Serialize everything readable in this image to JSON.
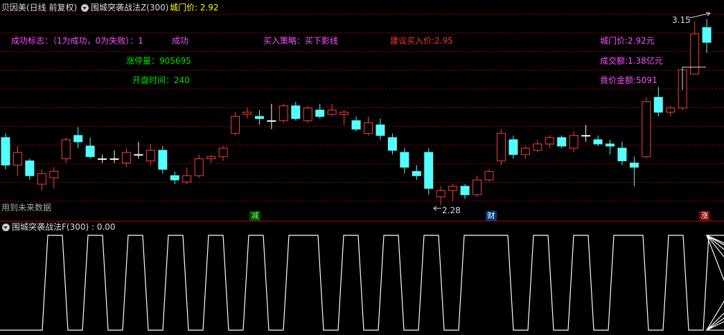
{
  "main_panel": {
    "stock_title": "贝因美(日线 前复权)",
    "indicator_title": "围城突袭战法Z(300)",
    "header_price_label": "城门价: 2.92",
    "high_marker": "3.15",
    "low_marker": "2.28",
    "future_data_note": "用到未来数据",
    "labels": {
      "success_flag": "成功标志：（1为成功，0为失败）：1",
      "success_text": "成功",
      "buy_strategy": "买入策略：买下影线",
      "suggested_price": "建议买入价:2.95",
      "city_gate_price": "城门价:2.92元",
      "limit_up_volume": "涨停量：905695",
      "turnover": "成交额:1.38亿元",
      "open_time": "开盘时间：240",
      "auction_amount": "竟价金额:5091"
    },
    "badges": {
      "reduce": "减",
      "finance": "财",
      "rise": "涨"
    }
  },
  "sub_panel": {
    "title": "围城突袭战法F(300) : 0.00"
  },
  "colors": {
    "up": "#ff3c3c",
    "down": "#54ffff",
    "flat": "#ffffff",
    "grid": "#7a0000",
    "magenta": "#ff50ff",
    "green": "#00e000",
    "yellow": "#ffff00"
  },
  "chart_data": [
    {
      "type": "candlestick",
      "title": "贝因美(日线 前复权)",
      "ohlc": [
        [
          2.6,
          2.62,
          2.45,
          2.47
        ],
        [
          2.47,
          2.56,
          2.42,
          2.53
        ],
        [
          2.49,
          2.5,
          2.4,
          2.42
        ],
        [
          2.38,
          2.45,
          2.35,
          2.43
        ],
        [
          2.41,
          2.46,
          2.36,
          2.44
        ],
        [
          2.5,
          2.6,
          2.48,
          2.59
        ],
        [
          2.61,
          2.65,
          2.55,
          2.58
        ],
        [
          2.56,
          2.6,
          2.5,
          2.51
        ],
        [
          2.5,
          2.52,
          2.48,
          2.5
        ],
        [
          2.5,
          2.54,
          2.48,
          2.5
        ],
        [
          2.48,
          2.55,
          2.46,
          2.53
        ],
        [
          2.52,
          2.58,
          2.5,
          2.52
        ],
        [
          2.49,
          2.57,
          2.47,
          2.54
        ],
        [
          2.54,
          2.56,
          2.43,
          2.45
        ],
        [
          2.42,
          2.44,
          2.38,
          2.4
        ],
        [
          2.39,
          2.46,
          2.38,
          2.42
        ],
        [
          2.42,
          2.52,
          2.41,
          2.5
        ],
        [
          2.5,
          2.52,
          2.48,
          2.51
        ],
        [
          2.51,
          2.56,
          2.49,
          2.55
        ],
        [
          2.62,
          2.72,
          2.61,
          2.7
        ],
        [
          2.71,
          2.74,
          2.69,
          2.72
        ],
        [
          2.7,
          2.73,
          2.66,
          2.69
        ],
        [
          2.68,
          2.76,
          2.64,
          2.68
        ],
        [
          2.68,
          2.76,
          2.67,
          2.75
        ],
        [
          2.75,
          2.77,
          2.68,
          2.69
        ],
        [
          2.68,
          2.75,
          2.67,
          2.74
        ],
        [
          2.73,
          2.76,
          2.69,
          2.7
        ],
        [
          2.71,
          2.76,
          2.7,
          2.73
        ],
        [
          2.71,
          2.73,
          2.66,
          2.72
        ],
        [
          2.68,
          2.7,
          2.63,
          2.64
        ],
        [
          2.62,
          2.7,
          2.61,
          2.67
        ],
        [
          2.66,
          2.69,
          2.59,
          2.61
        ],
        [
          2.6,
          2.62,
          2.52,
          2.54
        ],
        [
          2.53,
          2.55,
          2.43,
          2.46
        ],
        [
          2.44,
          2.47,
          2.4,
          2.42
        ],
        [
          2.53,
          2.55,
          2.33,
          2.36
        ],
        [
          2.32,
          2.37,
          2.28,
          2.35
        ],
        [
          2.35,
          2.38,
          2.3,
          2.37
        ],
        [
          2.37,
          2.38,
          2.31,
          2.33
        ],
        [
          2.33,
          2.42,
          2.32,
          2.4
        ],
        [
          2.4,
          2.45,
          2.39,
          2.44
        ],
        [
          2.49,
          2.64,
          2.47,
          2.62
        ],
        [
          2.59,
          2.61,
          2.5,
          2.52
        ],
        [
          2.52,
          2.56,
          2.5,
          2.55
        ],
        [
          2.54,
          2.59,
          2.53,
          2.57
        ],
        [
          2.57,
          2.61,
          2.55,
          2.6
        ],
        [
          2.6,
          2.61,
          2.55,
          2.56
        ],
        [
          2.55,
          2.63,
          2.53,
          2.61
        ],
        [
          2.61,
          2.66,
          2.58,
          2.61
        ],
        [
          2.59,
          2.61,
          2.56,
          2.57
        ],
        [
          2.57,
          2.59,
          2.52,
          2.56
        ],
        [
          2.55,
          2.58,
          2.47,
          2.49
        ],
        [
          2.48,
          2.51,
          2.37,
          2.46
        ],
        [
          2.51,
          2.79,
          2.5,
          2.77
        ],
        [
          2.79,
          2.84,
          2.7,
          2.72
        ],
        [
          2.72,
          2.75,
          2.7,
          2.74
        ],
        [
          2.74,
          2.92,
          2.73,
          2.92
        ],
        [
          2.9,
          3.15,
          2.9,
          3.09
        ],
        [
          3.12,
          3.16,
          3.0,
          3.05
        ]
      ],
      "ylim": [
        2.22,
        3.25
      ]
    },
    {
      "type": "line",
      "title": "围城突袭战法F(300)",
      "values": [
        0,
        1,
        0,
        1,
        0,
        1,
        0,
        1,
        0,
        1,
        0,
        1,
        0,
        1,
        1,
        0,
        1,
        0,
        1,
        0,
        1,
        0,
        1,
        1,
        1,
        0,
        1,
        0,
        1,
        0,
        1,
        1,
        0,
        1,
        0,
        1,
        1,
        0,
        1,
        0,
        1,
        0,
        1,
        1,
        0,
        1,
        0
      ],
      "ylim": [
        0,
        1
      ]
    }
  ]
}
